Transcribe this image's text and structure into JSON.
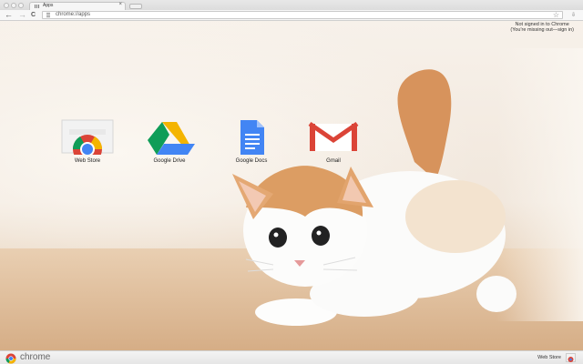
{
  "tab": {
    "title": "Apps",
    "close": "×"
  },
  "toolbar": {
    "back": "←",
    "forward": "→",
    "reload": "C",
    "url": "chrome://apps",
    "star": "☆",
    "download": "⇩"
  },
  "signin": {
    "line1": "Not signed in to Chrome",
    "line2": "(You're missing out—sign in)"
  },
  "apps": [
    {
      "label": "Web Store",
      "icon": "web-store-icon"
    },
    {
      "label": "Google Drive",
      "icon": "google-drive-icon"
    },
    {
      "label": "Google Docs",
      "icon": "google-docs-icon"
    },
    {
      "label": "Gmail",
      "icon": "gmail-icon"
    }
  ],
  "bottom": {
    "brand": "chrome",
    "webstore": "Web Store"
  },
  "colors": {
    "google_red": "#db4437",
    "google_green": "#0f9d58",
    "google_yellow": "#f4b400",
    "google_blue": "#4285f4"
  }
}
